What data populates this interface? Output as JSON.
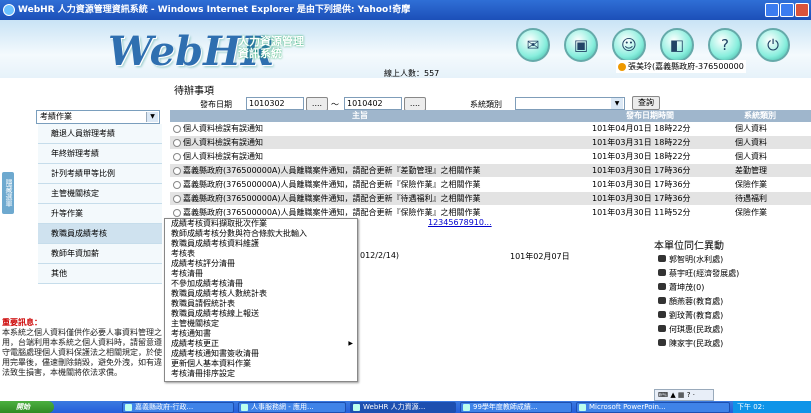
{
  "window": {
    "title": "WebHR 人力資源管理資訊系統 - Windows Internet Explorer 是由下列提供: Yahoo!奇摩"
  },
  "header": {
    "logo": "WebHR",
    "logo_sub": "人力資源管理資訊系統",
    "online": "線上人數：557",
    "user": "張美玲(嘉義縣政府-376500000"
  },
  "sidebar": {
    "module": "考績作業",
    "tab_label": "隱藏選單",
    "items": [
      "離退人員辦理考績",
      "年終辦理考績",
      "計列考績甲等比例",
      "主管機關核定",
      "升等作業",
      "教職員成績考核",
      "教師年資加薪",
      "其他"
    ],
    "notice_heading": "重要訊息：",
    "notice": "本系統之個人資料僅供作必要人事資料管理之用，台端利用本系統之個人資料時，請留意遵守電腦處理個人資料保護法之相關規定，於使用完畢後，儘速刪除銷毀，避免外洩，如有違法致生損害，本機關將依法求償。"
  },
  "main": {
    "title": "待辦事項",
    "filter": {
      "date_label": "發布日期",
      "date_from": "1010302",
      "sep": "～",
      "date_to": "1010402",
      "btn": "....",
      "category_label": "系統類別",
      "query": "查詢"
    },
    "columns": [
      "主旨",
      "發布日期時間",
      "系統類別"
    ],
    "rows": [
      {
        "subject": "個人資料檢誤有誤通知",
        "date": "101年04月01日 18時22分",
        "cat": "個人資料"
      },
      {
        "subject": "個人資料檢誤有誤通知",
        "date": "101年03月31日 18時22分",
        "cat": "個人資料"
      },
      {
        "subject": "個人資料檢誤有誤通知",
        "date": "101年03月30日 18時22分",
        "cat": "個人資料"
      },
      {
        "subject": "嘉義縣政府(376500000A)人員離職案件通知，請配合更新『差勤管理』之相關作業",
        "date": "101年03月30日 17時36分",
        "cat": "差勤管理"
      },
      {
        "subject": "嘉義縣政府(376500000A)人員離職案件通知，請配合更新『保險作業』之相關作業",
        "date": "101年03月30日 17時36分",
        "cat": "保險作業"
      },
      {
        "subject": "嘉義縣政府(376500000A)人員離職案件通知，請配合更新『待遇福利』之相關作業",
        "date": "101年03月30日 17時36分",
        "cat": "待遇福利"
      },
      {
        "subject": "嘉義縣政府(376500000A)人員離職案件通知，請配合更新『保險作業』之相關作業",
        "date": "101年03月30日 11時52分",
        "cat": "保險作業"
      }
    ],
    "pager": "12345678910...",
    "mid_row": "012/2/14)",
    "mid_date": "101年02月07日"
  },
  "menu": [
    "成績考核資料擷取批次作業",
    "教師成績考核分數與符合條款大批輸入",
    "教職員成績考核資料維護",
    "考核表",
    "成績考核評分清冊",
    "考核清冊",
    "不參加成績考核清冊",
    "教職員成績考核人數統計表",
    "教職員請假統計表",
    "教職員成績考核線上報送",
    "主管機關核定",
    "考核通知書",
    "成績考核更正",
    "成績考核通知書簽收清冊",
    "更新個人基本資料作業",
    "考核清冊排序設定"
  ],
  "colleagues": {
    "title": "本單位同仁異動",
    "items": [
      "郭智明(水利處)",
      "蔡宇旺(經濟發展處)",
      "蕭坤茂(0)",
      "顏燕蓉(教育處)",
      "劉玟菁(教育處)",
      "何琪惠(民政處)",
      "陳家宇(民政處)"
    ]
  },
  "taskbar": {
    "start": "開始",
    "tasks": [
      "嘉義縣政府-行政...",
      "人事服務網 - 應用...",
      "WebHR 人力資源...",
      "99學年度教師成績...",
      "Microsoft PowerPoin..."
    ],
    "clock": "下午 02:"
  }
}
